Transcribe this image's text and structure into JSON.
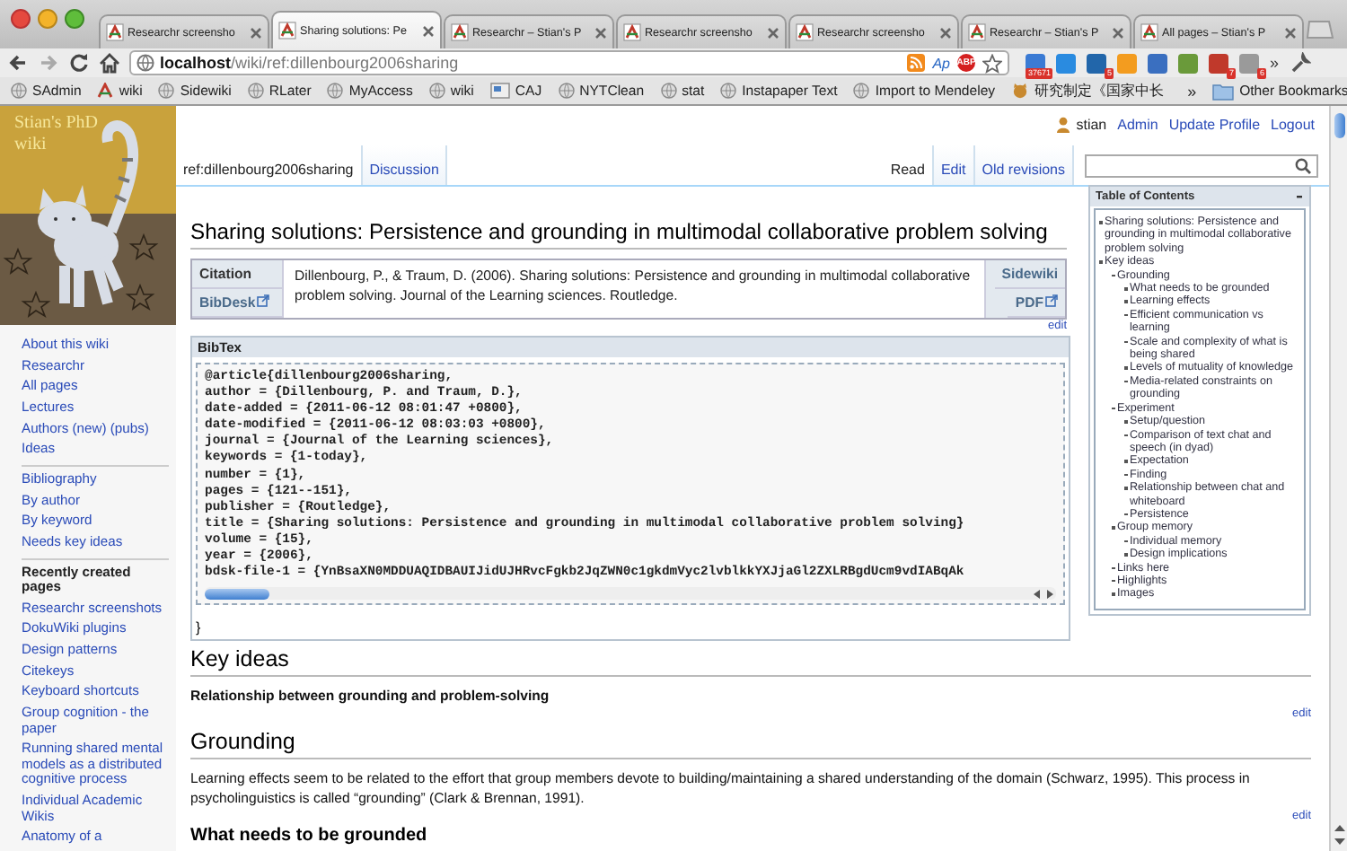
{
  "browser": {
    "tabs": [
      {
        "title": "Researchr screensho",
        "selected": false
      },
      {
        "title": "Sharing solutions: Pe",
        "selected": true
      },
      {
        "title": "Researchr – Stian's P",
        "selected": false
      },
      {
        "title": "Researchr screensho",
        "selected": false
      },
      {
        "title": "Researchr screensho",
        "selected": false
      },
      {
        "title": "Researchr – Stian's P",
        "selected": false
      },
      {
        "title": "All pages – Stian's P",
        "selected": false
      }
    ],
    "url": {
      "host": "localhost",
      "path": "/wiki/ref:dillenbourg2006sharing"
    },
    "url_actions": [
      {
        "kind": "rss"
      },
      {
        "kind": "text",
        "text": "Ap"
      },
      {
        "kind": "abp",
        "text": "ABP"
      },
      {
        "kind": "star"
      }
    ],
    "extensions": [
      {
        "color": "#3b7bd4",
        "badge": "37671"
      },
      {
        "color": "#2a8be0"
      },
      {
        "color": "#2266aa",
        "badge": "5"
      },
      {
        "color": "#f39c1f"
      },
      {
        "color": "#3a6fc0"
      },
      {
        "color": "#6a9a3a"
      },
      {
        "color": "#c0392b",
        "badge": "7"
      },
      {
        "color": "#9a9a9a",
        "badge": "6"
      }
    ],
    "extensions_more": "»",
    "bookmarks": [
      {
        "label": "SAdmin",
        "kind": "globe"
      },
      {
        "label": "wiki",
        "kind": "wiki"
      },
      {
        "label": "Sidewiki",
        "kind": "globe"
      },
      {
        "label": "RLater",
        "kind": "globe"
      },
      {
        "label": "MyAccess",
        "kind": "globe"
      },
      {
        "label": "wiki",
        "kind": "globe"
      },
      {
        "label": "CAJ",
        "kind": "doc"
      },
      {
        "label": "NYTClean",
        "kind": "globe"
      },
      {
        "label": "stat",
        "kind": "globe"
      },
      {
        "label": "Instapaper Text",
        "kind": "globe"
      },
      {
        "label": "Import to Mendeley",
        "kind": "globe"
      },
      {
        "label": "研究制定《国家中长",
        "kind": "pet"
      }
    ],
    "bookmarks_more": "»",
    "other_bookmarks": "Other Bookmarks"
  },
  "wiki": {
    "logo_text": "Stian's PhD wiki",
    "sidebar": {
      "groups": [
        {
          "items": [
            "About this wiki",
            "Researchr",
            "All pages",
            "Lectures",
            "Authors (new) (pubs)",
            "Ideas"
          ]
        },
        {
          "items": [
            "Bibliography",
            "By author",
            "By keyword",
            "Needs key ideas"
          ]
        }
      ],
      "recent": {
        "heading": "Recently created pages",
        "items": [
          "Researchr screenshots",
          "DokuWiki plugins",
          "Design patterns",
          "Citekeys",
          "Keyboard shortcuts",
          "Group cognition - the paper",
          "Running shared mental models as a distributed cognitive process",
          "Individual Academic Wikis",
          "Anatomy of a"
        ]
      }
    },
    "user": {
      "name": "stian",
      "links": [
        "Admin",
        "Update Profile",
        "Logout"
      ]
    },
    "page_tabs": [
      {
        "label": "ref:dillenbourg2006sharing",
        "selected": true
      },
      {
        "label": "Discussion",
        "selected": false
      }
    ],
    "view_tabs": [
      {
        "label": "Read",
        "selected": true
      },
      {
        "label": "Edit",
        "selected": false
      },
      {
        "label": "Old revisions",
        "selected": false
      }
    ],
    "title": "Sharing solutions: Persistence and grounding in multimodal collaborative problem solving",
    "citation": {
      "label": "Citation",
      "text": "Dillenbourg, P., & Traum, D. (2006). Sharing solutions: Persistence and grounding in multimodal collaborative problem solving. Journal of the Learning sciences. Routledge.",
      "bibdesk": "BibDesk",
      "sidewiki": "Sidewiki",
      "pdf": "PDF",
      "edit": "edit"
    },
    "bibtex": {
      "heading": "BibTex",
      "lines": [
        "@article{dillenbourg2006sharing,",
        "author = {Dillenbourg, P. and Traum, D.},",
        "date-added = {2011-06-12 08:01:47 +0800},",
        "date-modified = {2011-06-12 08:03:03 +0800},",
        "journal = {Journal of the Learning sciences},",
        "keywords = {1-today},",
        "number = {1},",
        "pages = {121--151},",
        "publisher = {Routledge},",
        "title = {Sharing solutions: Persistence and grounding in multimodal collaborative problem solving}",
        "volume = {15},",
        "year = {2006},",
        "bdsk-file-1 = {YnBsaXN0MDDUAQIDBAUIJidUJHRvcFgkb2JqZWN0c1gkdmVyc2lvblkkYXJjaGl2ZXLRBgdUcm9vdIABqAk"
      ],
      "closing": "}"
    },
    "toc": {
      "heading": "Table of Contents",
      "items": [
        {
          "text": "Sharing solutions: Persistence and grounding in multimodal collaborative problem solving"
        },
        {
          "text": "Key ideas",
          "children": [
            {
              "text": "Grounding",
              "children": [
                {
                  "text": "What needs to be grounded"
                },
                {
                  "text": "Learning effects"
                },
                {
                  "text": "Efficient communication vs learning"
                },
                {
                  "text": "Scale and complexity of what is being shared"
                },
                {
                  "text": "Levels of mutuality of knowledge"
                },
                {
                  "text": "Media-related constraints on grounding"
                }
              ]
            },
            {
              "text": "Experiment",
              "children": [
                {
                  "text": "Setup/question"
                },
                {
                  "text": "Comparison of text chat and speech (in dyad)"
                },
                {
                  "text": "Expectation"
                },
                {
                  "text": "Finding"
                },
                {
                  "text": "Relationship between chat and whiteboard"
                },
                {
                  "text": "Persistence"
                }
              ]
            },
            {
              "text": "Group memory",
              "children": [
                {
                  "text": "Individual memory"
                },
                {
                  "text": "Design implications"
                }
              ]
            },
            {
              "text": "Links here"
            },
            {
              "text": "Highlights"
            },
            {
              "text": "Images"
            }
          ]
        }
      ]
    },
    "sections": [
      {
        "kind": "h2",
        "text": "Key ideas"
      },
      {
        "kind": "strong",
        "text": "Relationship between grounding and problem-solving"
      },
      {
        "kind": "edit",
        "text": "edit"
      },
      {
        "kind": "h2",
        "text": "Grounding"
      },
      {
        "kind": "p",
        "text": "Learning effects seem to be related to the effort that group members devote to building/maintaining a shared understanding of the domain (Schwarz, 1995). This process in psycholinguistics is called “grounding” (Clark & Brennan, 1991)."
      },
      {
        "kind": "edit",
        "text": "edit"
      },
      {
        "kind": "h3",
        "text": "What needs to be grounded"
      }
    ]
  }
}
